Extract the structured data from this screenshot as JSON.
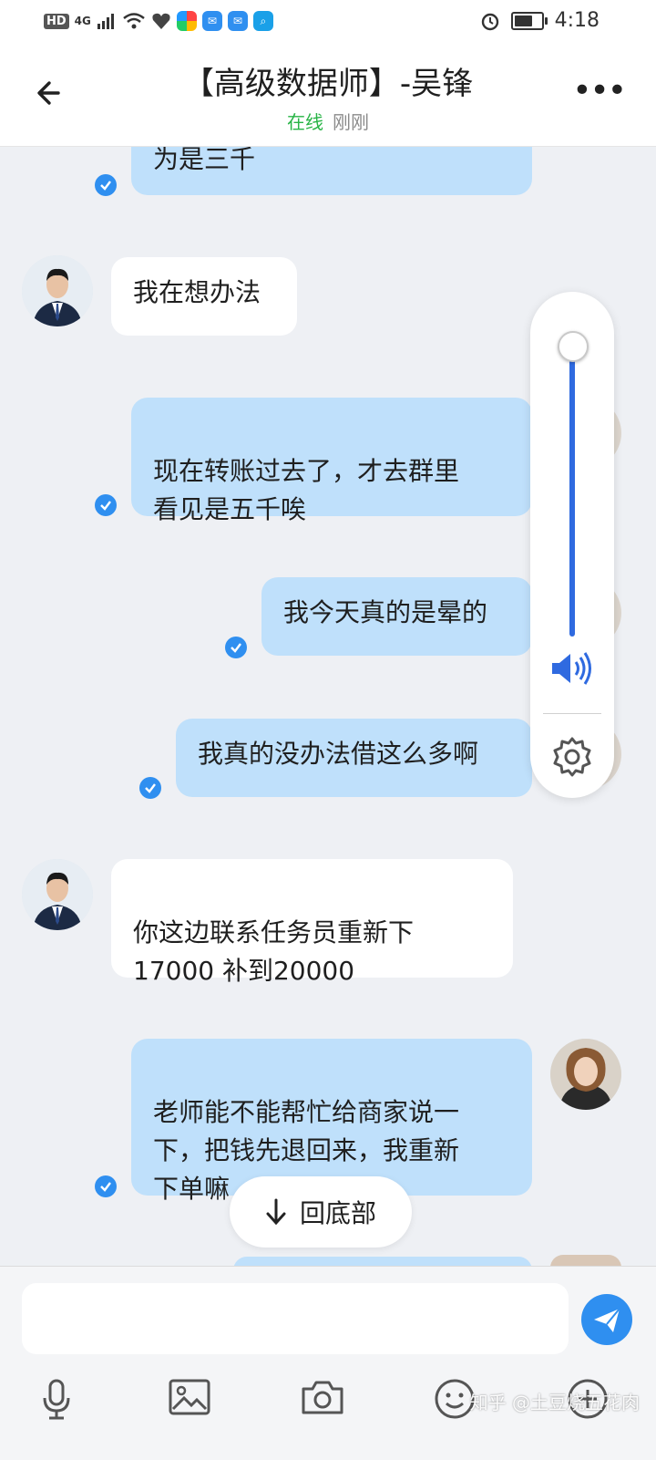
{
  "status_bar": {
    "network_badge": "HD",
    "signal_label": "4G",
    "time": "4:18"
  },
  "header": {
    "title": "【高级数据师】-吴锋",
    "status_online": "在线",
    "status_time": "刚刚"
  },
  "messages": [
    {
      "direction": "out",
      "text": "为是三千",
      "read": true
    },
    {
      "direction": "in",
      "text": "我在想办法"
    },
    {
      "direction": "out",
      "text": "现在转账过去了，才去群里\n看见是五千唉",
      "read": true
    },
    {
      "direction": "out",
      "text": "我今天真的是晕的",
      "read": true
    },
    {
      "direction": "out",
      "text": "我真的没办法借这么多啊",
      "read": true
    },
    {
      "direction": "in",
      "text": "你这边联系任务员重新下\n17000  补到20000"
    },
    {
      "direction": "out",
      "text": "老师能不能帮忙给商家说一\n下，把钱先退回来，我重新\n下单嘛",
      "read": true
    }
  ],
  "volume_overlay": {
    "level": 1.0
  },
  "back_to_bottom": {
    "label": "回底部"
  },
  "input": {
    "value": "",
    "placeholder": ""
  },
  "watermark": "知乎 @土豆烧五花肉",
  "colors": {
    "accent": "#2f8ff0",
    "outgoing_bubble": "#bfe0fb",
    "incoming_bubble": "#ffffff",
    "background": "#eef0f4",
    "online": "#28b446"
  },
  "icons": [
    "back-arrow-icon",
    "more-icon",
    "read-check-icon",
    "speaker-icon",
    "settings-gear-icon",
    "down-arrow-icon",
    "send-icon",
    "microphone-icon",
    "image-icon",
    "camera-icon",
    "emoji-icon",
    "plus-icon"
  ]
}
